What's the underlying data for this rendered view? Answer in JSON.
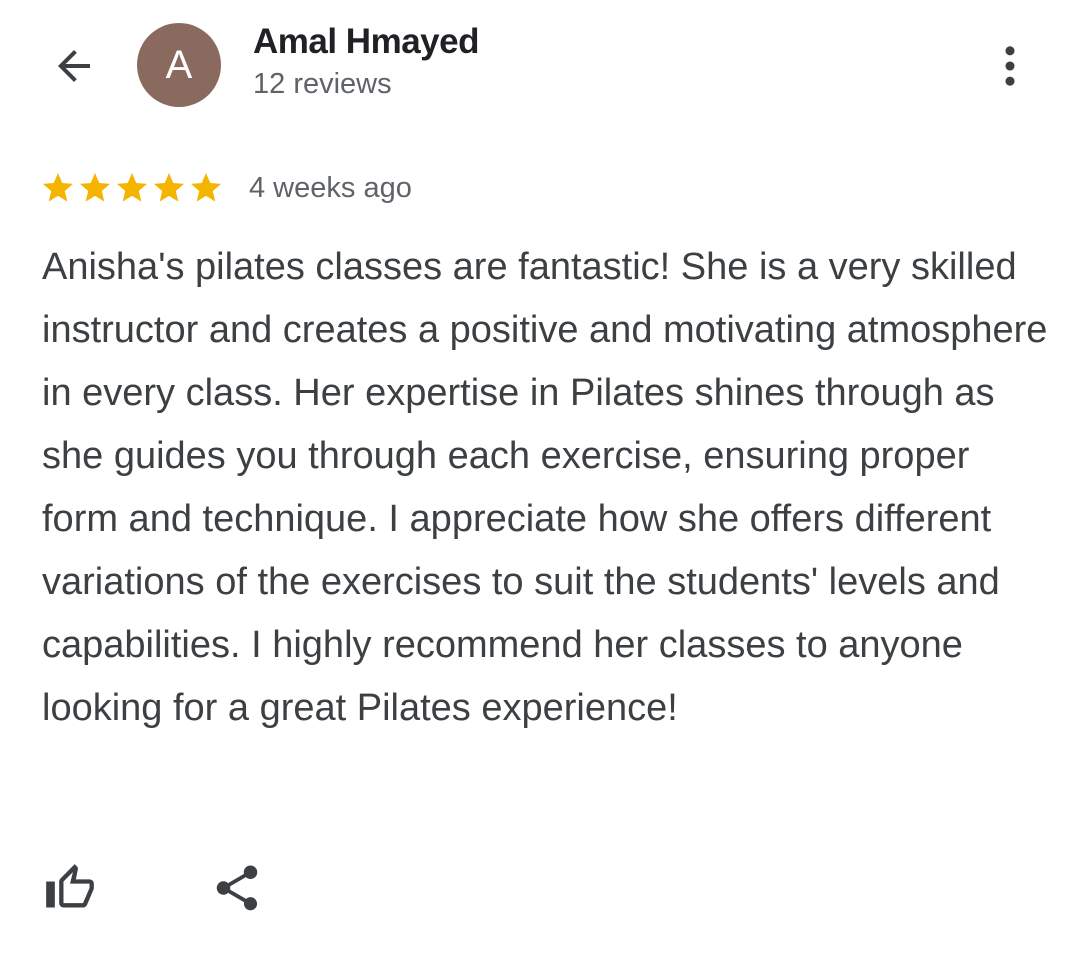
{
  "header": {
    "back_icon": "arrow-back-icon",
    "avatar_letter": "A",
    "avatar_color": "#8a6a5f",
    "author_name": "Amal Hmayed",
    "review_count": "12 reviews",
    "menu_icon": "more-vert-icon"
  },
  "review": {
    "rating": 5,
    "rating_max": 5,
    "star_color": "#f4b400",
    "time_ago": "4 weeks ago",
    "text": "Anisha's pilates classes are fantastic! She is a very skilled instructor and creates a positive and motivating atmosphere in every class. Her expertise in Pilates shines through as she guides you through each exercise, ensuring proper form and technique. I appreciate how she offers different variations of the exercises to suit the students' levels and capabilities. I highly recommend her classes to anyone looking for a great Pilates experience!"
  },
  "actions": {
    "like_icon": "thumb-up-icon",
    "share_icon": "share-icon"
  }
}
